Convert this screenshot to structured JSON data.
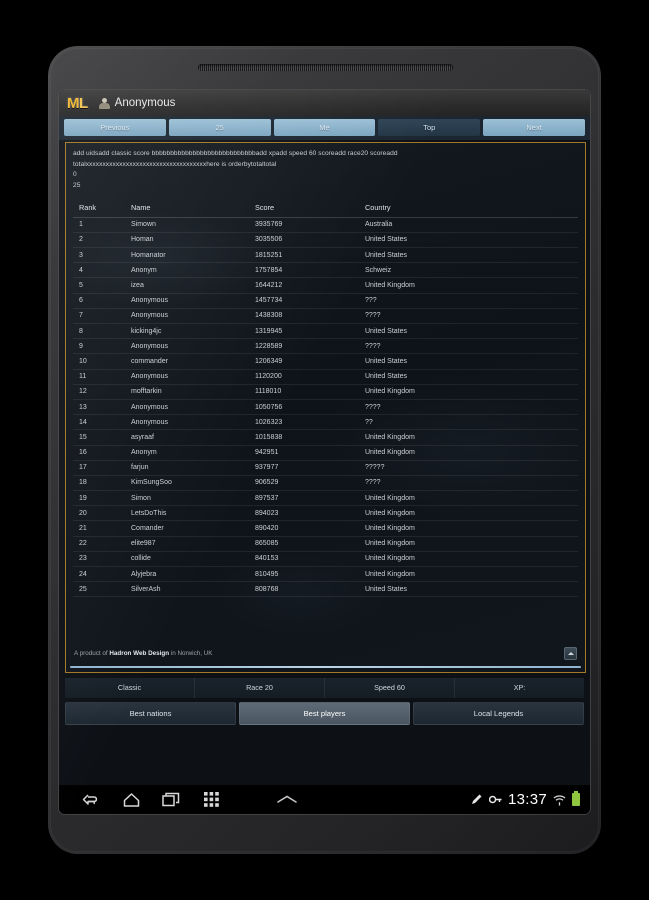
{
  "app": {
    "logo_m": "M",
    "logo_l": "L",
    "username": "Anonymous"
  },
  "pager": {
    "tabs": [
      {
        "label": "Previous",
        "active": false
      },
      {
        "label": "25",
        "active": false
      },
      {
        "label": "Me",
        "active": false
      },
      {
        "label": "Top",
        "active": true
      },
      {
        "label": "Next",
        "active": false
      }
    ]
  },
  "debug": {
    "line1": "add uidsadd classic score bbbbbbbbbbbbbbbbbbbbbbbbbbbbadd xpadd speed 60 scoreadd race20 scoreadd",
    "line2": "totalxxxxxxxxxxxxxxxxxxxxxxxxxxxxxxxxxxxxhere is orderbytotaltotal",
    "line3": "0",
    "line4": "25"
  },
  "table": {
    "headers": [
      "Rank",
      "Name",
      "Score",
      "Country"
    ],
    "rows": [
      {
        "rank": "1",
        "name": "Simown",
        "score": "3935769",
        "country": "Australia"
      },
      {
        "rank": "2",
        "name": "Homan",
        "score": "3035506",
        "country": "United States"
      },
      {
        "rank": "3",
        "name": "Homanator",
        "score": "1815251",
        "country": "United States"
      },
      {
        "rank": "4",
        "name": "Anonym",
        "score": "1757854",
        "country": "Schweiz"
      },
      {
        "rank": "5",
        "name": "izea",
        "score": "1644212",
        "country": "United Kingdom"
      },
      {
        "rank": "6",
        "name": "Anonymous",
        "score": "1457734",
        "country": "???"
      },
      {
        "rank": "7",
        "name": "Anonymous",
        "score": "1438308",
        "country": "????"
      },
      {
        "rank": "8",
        "name": "kicking4jc",
        "score": "1319945",
        "country": "United States"
      },
      {
        "rank": "9",
        "name": "Anonymous",
        "score": "1228589",
        "country": "????"
      },
      {
        "rank": "10",
        "name": "commander",
        "score": "1206349",
        "country": "United States"
      },
      {
        "rank": "11",
        "name": "Anonymous",
        "score": "1120200",
        "country": "United States"
      },
      {
        "rank": "12",
        "name": "mofftarkin",
        "score": "1118010",
        "country": "United Kingdom"
      },
      {
        "rank": "13",
        "name": "Anonymous",
        "score": "1050756",
        "country": "????"
      },
      {
        "rank": "14",
        "name": "Anonymous",
        "score": "1026323",
        "country": "??"
      },
      {
        "rank": "15",
        "name": "asyraaf",
        "score": "1015838",
        "country": "United Kingdom"
      },
      {
        "rank": "16",
        "name": "Anonym",
        "score": "942951",
        "country": "United Kingdom"
      },
      {
        "rank": "17",
        "name": "farjun",
        "score": "937977",
        "country": "?????"
      },
      {
        "rank": "18",
        "name": "KimSungSoo",
        "score": "906529",
        "country": "????"
      },
      {
        "rank": "19",
        "name": "Simon",
        "score": "897537",
        "country": "United Kingdom"
      },
      {
        "rank": "20",
        "name": "LetsDoThis",
        "score": "894023",
        "country": "United Kingdom"
      },
      {
        "rank": "21",
        "name": "Comander",
        "score": "890420",
        "country": "United Kingdom"
      },
      {
        "rank": "22",
        "name": "elite987",
        "score": "865085",
        "country": "United Kingdom"
      },
      {
        "rank": "23",
        "name": "collide",
        "score": "840153",
        "country": "United Kingdom"
      },
      {
        "rank": "24",
        "name": "Alyjebra",
        "score": "810495",
        "country": "United Kingdom"
      },
      {
        "rank": "25",
        "name": "SilverAsh",
        "score": "808768",
        "country": "United States"
      }
    ]
  },
  "credit": {
    "prefix": "A product of ",
    "company": "Hadron Web Design",
    "suffix": " in Norwich, UK"
  },
  "modes": [
    {
      "label": "Classic"
    },
    {
      "label": "Race 20"
    },
    {
      "label": "Speed 60"
    },
    {
      "label": "XP:"
    }
  ],
  "sections": [
    {
      "label": "Best nations",
      "active": false
    },
    {
      "label": "Best players",
      "active": true
    },
    {
      "label": "Local Legends",
      "active": false
    }
  ],
  "navbar": {
    "clock": "13:37",
    "icons": [
      "back-icon",
      "home-icon",
      "recents-icon",
      "apps-grid-icon",
      "chevron-up-icon",
      "pen-icon",
      "key-icon",
      "wifi-icon",
      "battery-icon"
    ]
  },
  "colors": {
    "accent_gold": "#f0b72a",
    "panel_border": "#a07a26",
    "tab_blue": "#7ba5c0",
    "battery_green": "#8ec63f"
  }
}
